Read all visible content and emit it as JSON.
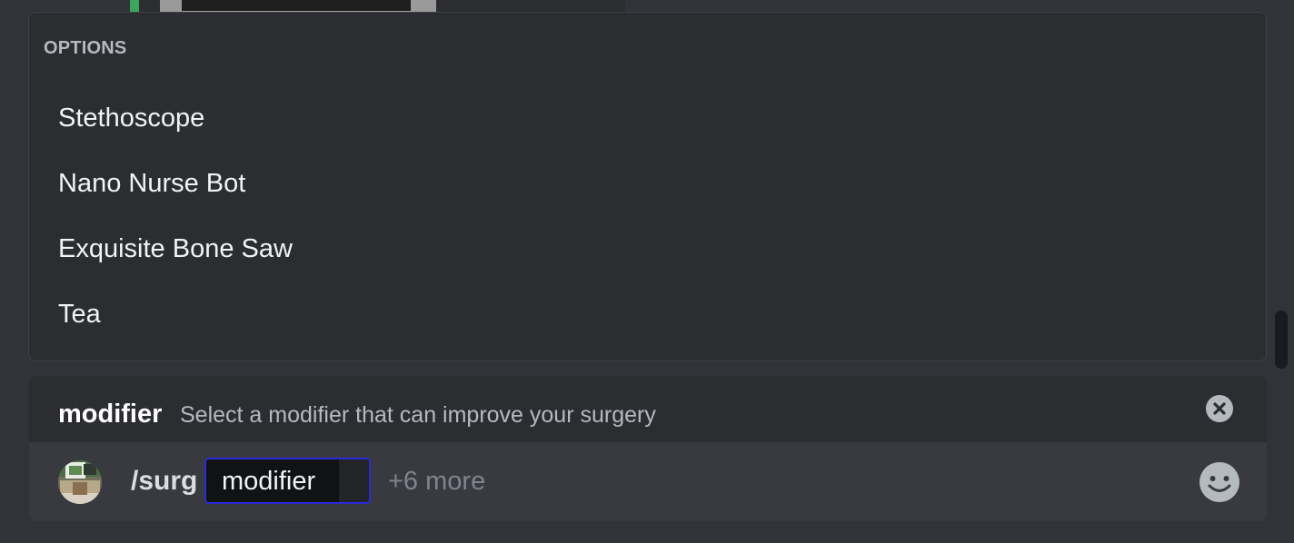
{
  "options": {
    "header": "OPTIONS",
    "items": [
      {
        "label": "Stethoscope"
      },
      {
        "label": "Nano Nurse Bot"
      },
      {
        "label": "Exquisite Bone Saw"
      },
      {
        "label": "Tea"
      }
    ]
  },
  "command_info": {
    "option_name": "modifier",
    "option_description": "Select a modifier that can improve your surgery"
  },
  "input": {
    "command": "/surg",
    "active_option_label": "modifier",
    "active_option_value": "",
    "more_options": "+6 more"
  },
  "icons": {
    "close": "close-circle-icon",
    "emoji": "smiley-face-icon",
    "avatar": "user-avatar"
  },
  "colors": {
    "background": "#313338",
    "panel": "#2b2d31",
    "input_bar": "#383a40",
    "focus_border": "#2b2bd9",
    "text_primary": "#f2f3f5",
    "text_muted": "#b5bac1"
  }
}
